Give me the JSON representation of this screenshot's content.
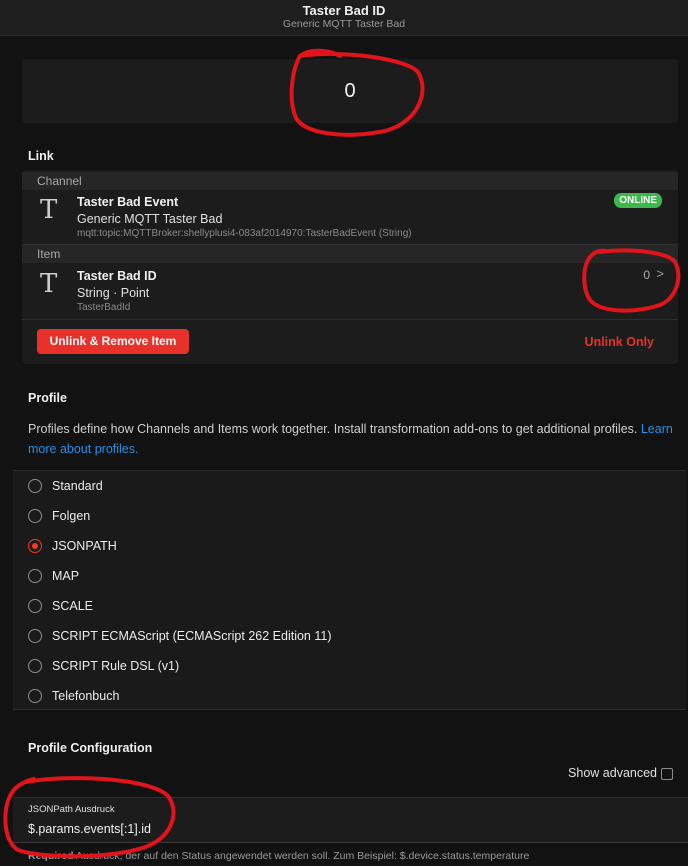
{
  "header": {
    "title": "Taster Bad ID",
    "subtitle": "Generic MQTT Taster Bad"
  },
  "state": {
    "value": "0"
  },
  "link": {
    "section_title": "Link",
    "channel": {
      "group_label": "Channel",
      "icon": "T",
      "title": "Taster Bad Event",
      "subtitle": "Generic MQTT Taster Bad",
      "uid": "mqtt:topic:MQTTBroker:shellyplusi4-083af2014970:TasterBadEvent (String)",
      "status": "ONLINE",
      "status_color": "#3db84c"
    },
    "item": {
      "group_label": "Item",
      "icon": "T",
      "title": "Taster Bad ID",
      "subtitle": "String · Point",
      "name": "TasterBadId",
      "value": "0",
      "chevron": ">"
    },
    "unlink_remove_label": "Unlink & Remove Item",
    "unlink_only_label": "Unlink Only"
  },
  "profile": {
    "section_title": "Profile",
    "description": "Profiles define how Channels and Items work together. Install transformation add-ons to get additional profiles.",
    "learn_more": "Learn more about profiles.",
    "options": [
      {
        "label": "Standard",
        "selected": false
      },
      {
        "label": "Folgen",
        "selected": false
      },
      {
        "label": "JSONPATH",
        "selected": true
      },
      {
        "label": "MAP",
        "selected": false
      },
      {
        "label": "SCALE",
        "selected": false
      },
      {
        "label": "SCRIPT ECMAScript (ECMAScript 262 Edition 11)",
        "selected": false
      },
      {
        "label": "SCRIPT Rule DSL (v1)",
        "selected": false
      },
      {
        "label": "Telefonbuch",
        "selected": false
      }
    ]
  },
  "profile_config": {
    "section_title": "Profile Configuration",
    "show_advanced_label": "Show advanced",
    "field_label": "JSONPath Ausdruck",
    "field_value": "$.params.events[:1].id",
    "help_required": "Required",
    "help_text": " Ausdruck, der auf den Status angewendet werden soll. Zum Beispiel: $.device.status.temperature"
  },
  "colors": {
    "accent_red": "#e8312a",
    "link_blue": "#2b8fe3",
    "background": "#121212",
    "annotation_red": "#e0141a"
  }
}
